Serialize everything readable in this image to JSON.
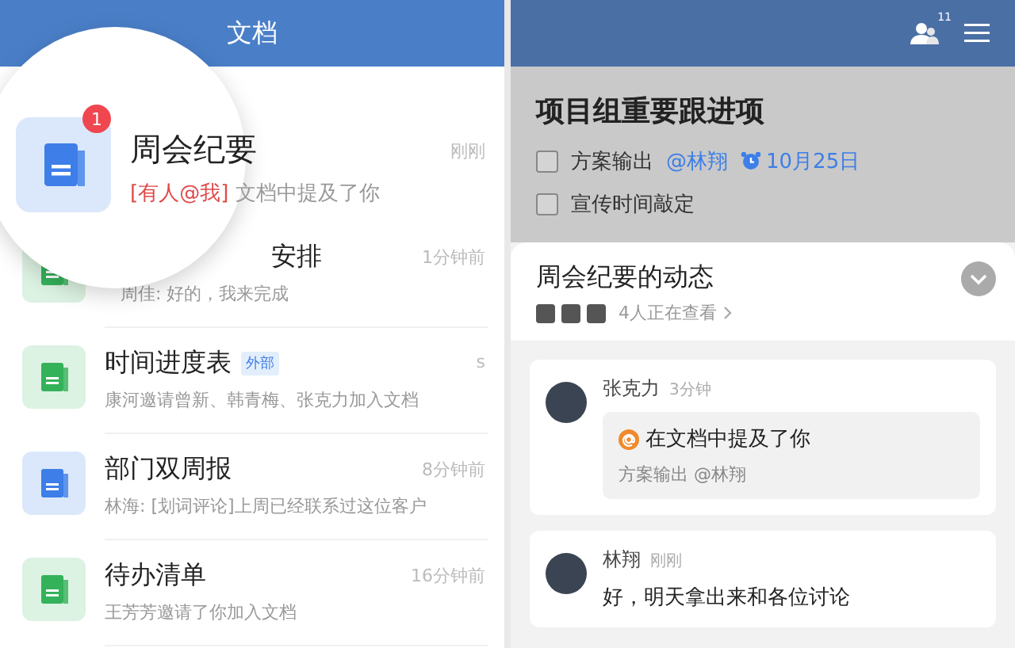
{
  "left": {
    "title": "文档",
    "docs": [
      {
        "kind": "doc",
        "title": "周会纪要",
        "mention": "[有人@我]",
        "preview": "文档中提及了你",
        "time": "刚刚",
        "badge": "1",
        "magnified": true
      },
      {
        "kind": "sheet",
        "title": "安排",
        "preview": "周佳: 好的，我来完成",
        "time": "1分钟前",
        "magnified": false
      },
      {
        "kind": "sheet",
        "title": "时间进度表",
        "tag": "外部",
        "preview": "康河邀请曾新、韩青梅、张克力加入文档",
        "time": "s",
        "magnified": false
      },
      {
        "kind": "doc",
        "title": "部门双周报",
        "preview": "林海: [划词评论]上周已经联系过这位客户",
        "time": "8分钟前",
        "magnified": false
      },
      {
        "kind": "sheet",
        "title": "待办清单",
        "preview": "王芳芳邀请了你加入文档",
        "time": "16分钟前",
        "magnified": false
      }
    ]
  },
  "right": {
    "header": {
      "members_badge": "11"
    },
    "checklist": {
      "title": "项目组重要跟进项",
      "items": [
        {
          "text": "方案输出",
          "mention": "@林翔",
          "due": "10月25日",
          "checked": false
        },
        {
          "text": "宣传时间敲定",
          "checked": false
        }
      ]
    },
    "activity": {
      "title": "周会纪要的动态",
      "viewers": "4人正在查看",
      "feed": [
        {
          "kind": "mention",
          "name": "张克力",
          "time": "3分钟",
          "headline": "在文档中提及了你",
          "quote": "方案输出 @林翔"
        },
        {
          "kind": "comment",
          "name": "林翔",
          "time": "刚刚",
          "text": "好，明天拿出来和各位讨论"
        }
      ]
    }
  }
}
